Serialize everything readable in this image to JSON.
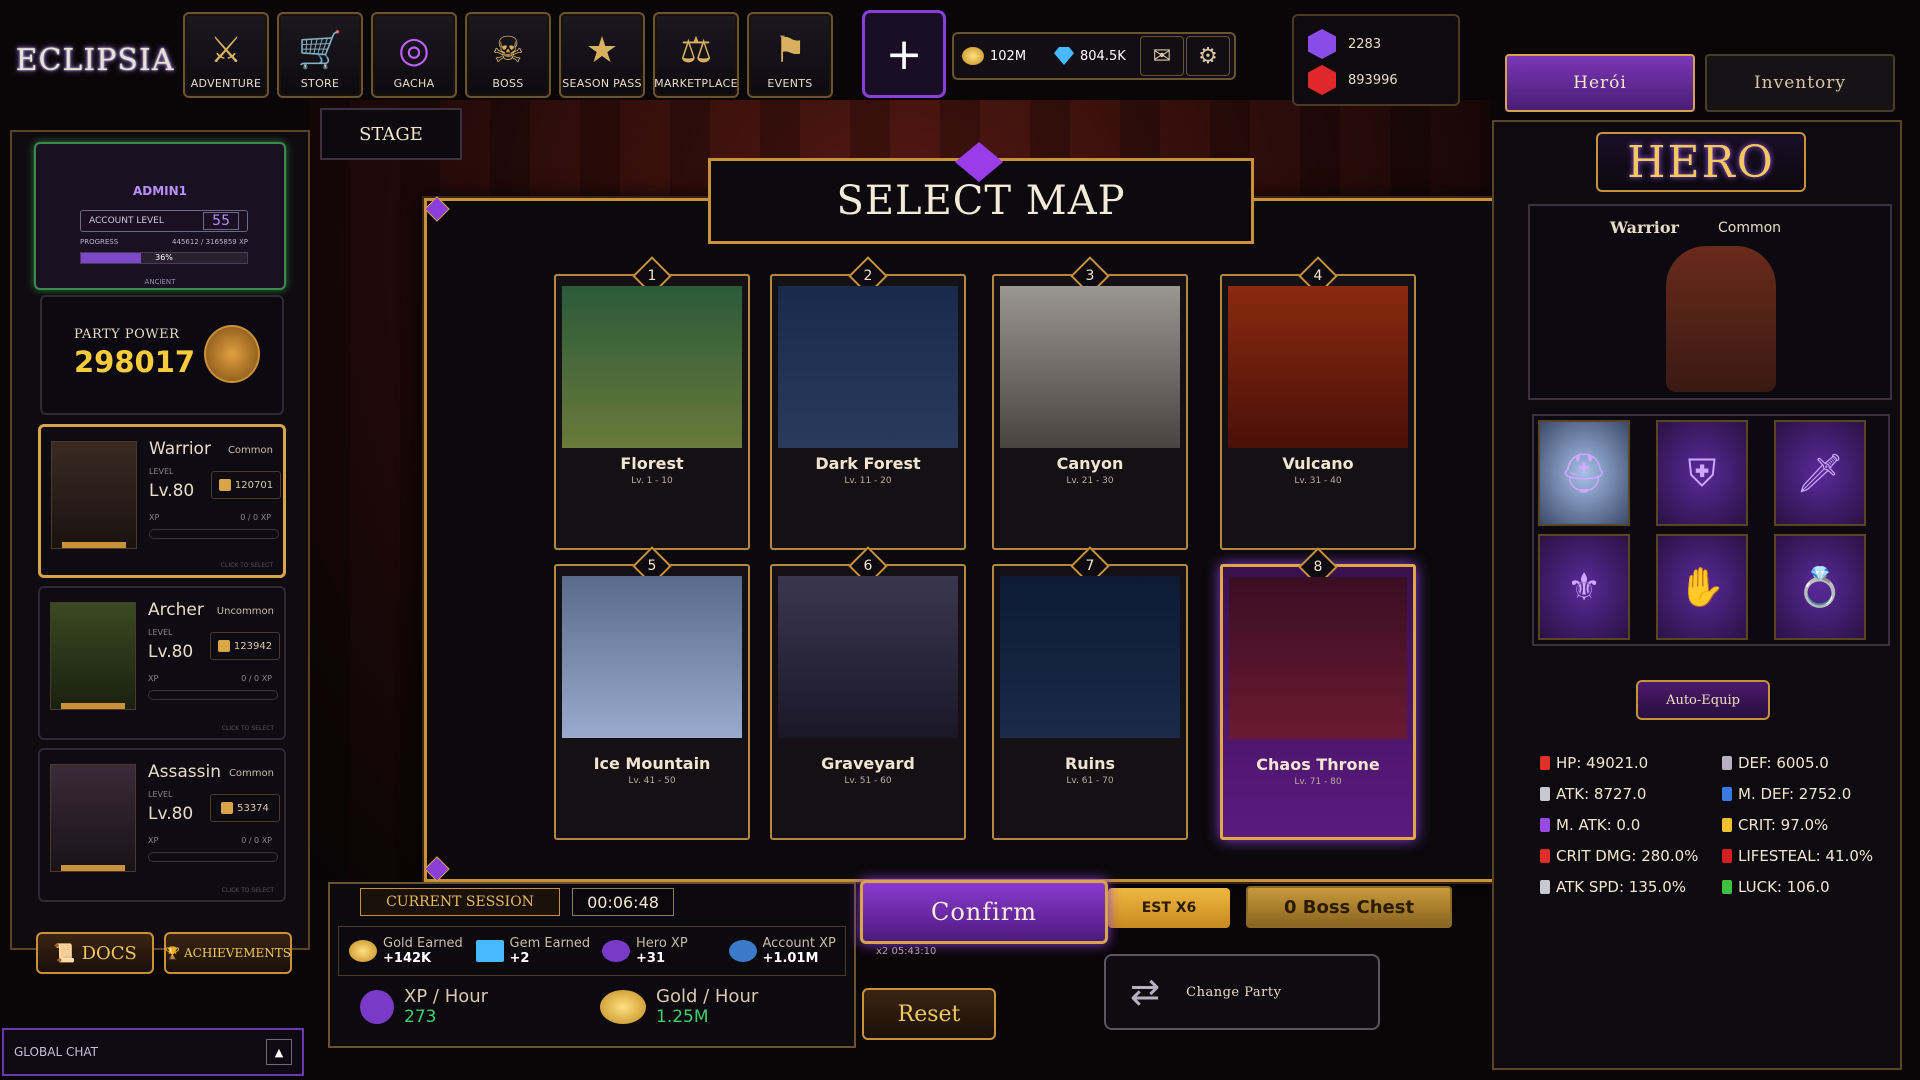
{
  "app": {
    "logo": "ECLIPSIA"
  },
  "nav": [
    {
      "label": "ADVENTURE",
      "icon": "⚔"
    },
    {
      "label": "STORE",
      "icon": "🛒"
    },
    {
      "label": "GACHA",
      "icon": "◎"
    },
    {
      "label": "BOSS",
      "icon": "☠"
    },
    {
      "label": "SEASON PASS",
      "icon": "★"
    },
    {
      "label": "MARKETPLACE",
      "icon": "⚖"
    },
    {
      "label": "EVENTS",
      "icon": "⚑"
    }
  ],
  "plus_label": "+",
  "currency": {
    "gold": "102M",
    "diamond": "804.5K"
  },
  "gems": {
    "purple": "2283",
    "red": "893996"
  },
  "tabs": {
    "hero": "Herói",
    "inventory": "Inventory"
  },
  "profile": {
    "name": "ADMIN1",
    "account_level_label": "ACCOUNT LEVEL",
    "account_level": "55",
    "progress_label": "PROGRESS",
    "progress_text": "445612 / 3165859 XP",
    "progress_percent": "36%",
    "progress_fraction": 0.36,
    "rank": "ANCIENT"
  },
  "party_power": {
    "label": "PARTY POWER",
    "value": "298017"
  },
  "heroes": [
    {
      "name": "Warrior",
      "rarity": "Common",
      "level_label": "LEVEL",
      "level": "Lv.80",
      "power": "120701",
      "xp_label": "XP",
      "xp": "0 / 0 XP",
      "hint": "CLICK TO SELECT",
      "selected": true
    },
    {
      "name": "Archer",
      "rarity": "Uncommon",
      "level_label": "LEVEL",
      "level": "Lv.80",
      "power": "123942",
      "xp_label": "XP",
      "xp": "0 / 0 XP",
      "hint": "CLICK TO SELECT",
      "selected": false
    },
    {
      "name": "Assassin",
      "rarity": "Common",
      "level_label": "LEVEL",
      "level": "Lv.80",
      "power": "53374",
      "xp_label": "XP",
      "xp": "0 / 0 XP",
      "hint": "CLICK TO SELECT",
      "selected": false
    }
  ],
  "buttons": {
    "docs": "DOCS",
    "achievements": "ACHIEVEMENTS",
    "stage": "STAGE",
    "confirm": "Confirm",
    "reset": "Reset",
    "change_party": "Change Party",
    "auto_equip": "Auto-Equip"
  },
  "chat": {
    "label": "GLOBAL CHAT",
    "toggle": "▲"
  },
  "modal": {
    "title": "SELECT MAP"
  },
  "maps": [
    {
      "num": "1",
      "name": "Florest",
      "levels": "Lv. 1 - 10",
      "colors": [
        "#2a5a3a",
        "#6a7a3a"
      ]
    },
    {
      "num": "2",
      "name": "Dark Forest",
      "levels": "Lv. 11 - 20",
      "colors": [
        "#1a2a4a",
        "#2a3a5a"
      ]
    },
    {
      "num": "3",
      "name": "Canyon",
      "levels": "Lv. 21 - 30",
      "colors": [
        "#9a9690",
        "#4a4440"
      ]
    },
    {
      "num": "4",
      "name": "Vulcano",
      "levels": "Lv. 31 - 40",
      "colors": [
        "#8a2a10",
        "#4a1008"
      ]
    },
    {
      "num": "5",
      "name": "Ice Mountain",
      "levels": "Lv. 41 - 50",
      "colors": [
        "#5a6a8a",
        "#9aaace"
      ]
    },
    {
      "num": "6",
      "name": "Graveyard",
      "levels": "Lv. 51 - 60",
      "colors": [
        "#3a3650",
        "#1a1828"
      ]
    },
    {
      "num": "7",
      "name": "Ruins",
      "levels": "Lv. 61 - 70",
      "colors": [
        "#0e1a34",
        "#1a2a4a"
      ]
    },
    {
      "num": "8",
      "name": "Chaos Throne",
      "levels": "Lv. 71 - 80",
      "colors": [
        "#3a0e24",
        "#6a1a30"
      ]
    }
  ],
  "session": {
    "label": "CURRENT SESSION",
    "time": "00:06:48",
    "gold_label": "Gold Earned",
    "gold": "+142K",
    "gem_label": "Gem Earned",
    "gem": "+2",
    "hero_xp_label": "Hero XP",
    "hero_xp": "+31",
    "account_xp_label": "Account XP",
    "account_xp": "+1.01M",
    "xp_hour_label": "XP / Hour",
    "xp_hour": "273",
    "gold_hour_label": "Gold / Hour",
    "gold_hour": "1.25M",
    "timer_small": "x2  05:43:10"
  },
  "chests": {
    "x6": "EST X6",
    "boss": "0 Boss Chest"
  },
  "hero_panel": {
    "title": "HERO",
    "class": "Warrior",
    "rarity": "Common"
  },
  "stats": [
    {
      "text": "HP: 49021.0",
      "color": "#e0302a"
    },
    {
      "text": "DEF: 6005.0",
      "color": "#b8b0c0"
    },
    {
      "text": "ATK: 8727.0",
      "color": "#c8c8d0"
    },
    {
      "text": "M. DEF: 2752.0",
      "color": "#3a7ae0"
    },
    {
      "text": "M. ATK: 0.0",
      "color": "#9a4ae0"
    },
    {
      "text": "CRIT: 97.0%",
      "color": "#f0c030"
    },
    {
      "text": "CRIT DMG: 280.0%",
      "color": "#e0302a"
    },
    {
      "text": "LIFESTEAL: 41.0%",
      "color": "#d02020"
    },
    {
      "text": "ATK SPD: 135.0%",
      "color": "#c8c8d0"
    },
    {
      "text": "LUCK: 106.0",
      "color": "#40c040"
    }
  ]
}
